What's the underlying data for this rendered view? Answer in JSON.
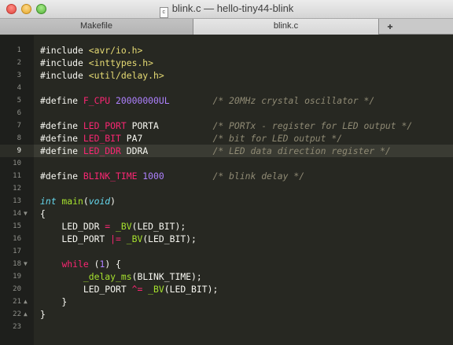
{
  "window": {
    "title": "blink.c — hello-tiny44-blink",
    "file_icon_label": "c"
  },
  "tabs": [
    {
      "label": "Makefile",
      "active": false
    },
    {
      "label": "blink.c",
      "active": true
    }
  ],
  "tab_add_label": "✚",
  "current_line": 9,
  "line_numbers": [
    "1",
    "2",
    "3",
    "4",
    "5",
    "6",
    "7",
    "8",
    "9",
    "10",
    "11",
    "12",
    "13",
    "14",
    "15",
    "16",
    "17",
    "18",
    "19",
    "20",
    "21",
    "22",
    "23"
  ],
  "fold_markers": {
    "14": "▼",
    "18": "▼",
    "21": "▲",
    "22": "▲"
  },
  "code": {
    "l1": {
      "pp": "#include",
      "str": " <avr/io.h>"
    },
    "l2": {
      "pp": "#include",
      "str": " <inttypes.h>"
    },
    "l3": {
      "pp": "#include",
      "str": " <util/delay.h>"
    },
    "l5": {
      "pp": "#define",
      "name": " F_CPU",
      "num": " 20000000UL",
      "gap": "        ",
      "cm": "/* 20MHz crystal oscillator */"
    },
    "l7": {
      "pp": "#define",
      "name": " LED_PORT",
      "val": " PORTA",
      "gap": "          ",
      "cm": "/* PORTx - register for LED output */"
    },
    "l8": {
      "pp": "#define",
      "name": " LED_BIT",
      "val": " PA7",
      "gap": "             ",
      "cm": "/* bit for LED output */"
    },
    "l9": {
      "pp": "#define",
      "name": " LED_DDR",
      "val": " DDRA",
      "gap": "            ",
      "cm": "/* LED data direction register */"
    },
    "l11": {
      "pp": "#define",
      "name": " BLINK_TIME",
      "num": " 1000",
      "gap": "         ",
      "cm": "/* blink delay */"
    },
    "l13": {
      "ty": "int",
      "fn": " main",
      "rest1": "(",
      "ty2": "void",
      "rest2": ")"
    },
    "l14": {
      "text": "{"
    },
    "l15": {
      "a": "    LED_DDR ",
      "op": "=",
      "b": " ",
      "fn": "_BV",
      "c": "(LED_BIT);"
    },
    "l16": {
      "a": "    LED_PORT ",
      "op": "|=",
      "b": " ",
      "fn": "_BV",
      "c": "(LED_BIT);"
    },
    "l18": {
      "a": "    ",
      "kw": "while",
      "b": " (",
      "num": "1",
      "c": ") {"
    },
    "l19": {
      "a": "        ",
      "fn": "_delay_ms",
      "c": "(BLINK_TIME);"
    },
    "l20": {
      "a": "        LED_PORT ",
      "op": "^=",
      "b": " ",
      "fn": "_BV",
      "c": "(LED_BIT);"
    },
    "l21": {
      "text": "    }"
    },
    "l22": {
      "text": "}"
    }
  }
}
